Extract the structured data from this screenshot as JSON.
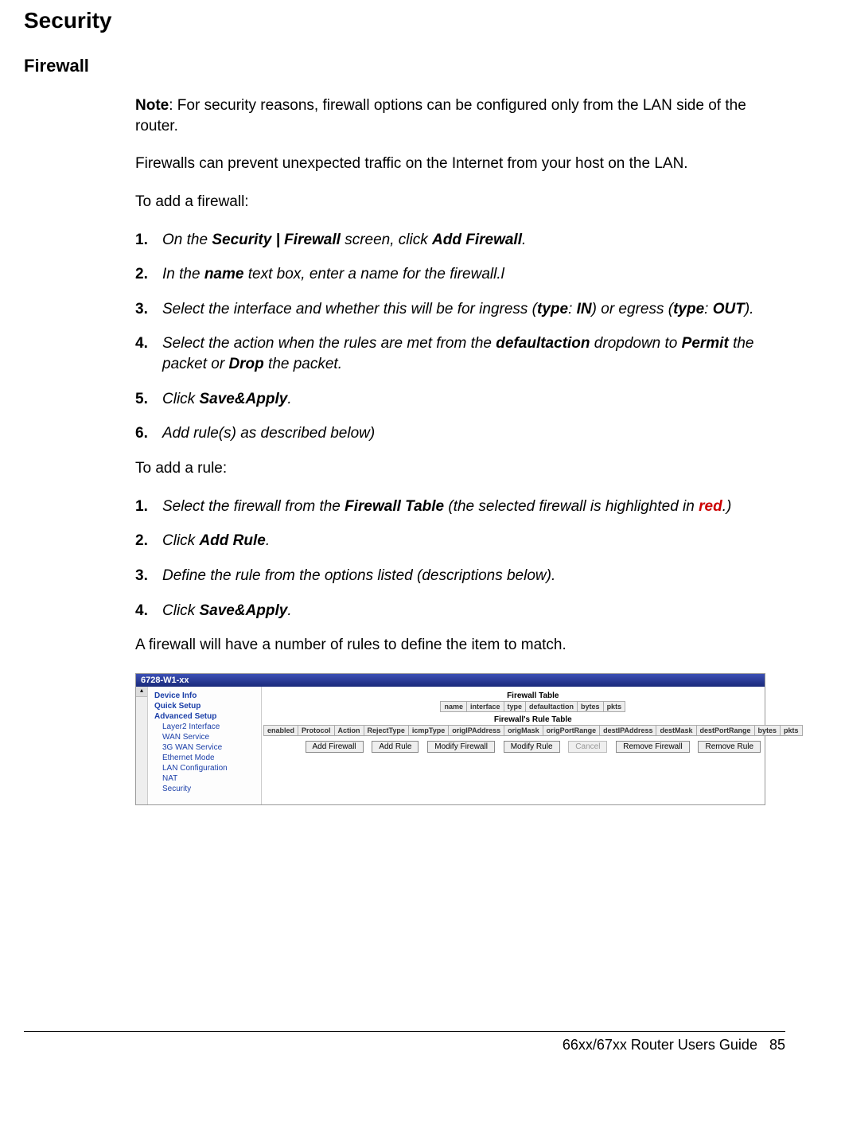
{
  "headings": {
    "h1": "Security",
    "h2": "Firewall"
  },
  "note": {
    "label": "Note",
    "text": ": For security reasons, firewall options can be configured only from the LAN side of the router."
  },
  "p_intro": "Firewalls can prevent unexpected traffic on the Internet from your host on the LAN.",
  "p_add_fw": "To add a firewall:",
  "steps_fw": [
    {
      "n": "1.",
      "pre": "On the ",
      "b1": "Security | Firewall",
      "mid": " screen, click ",
      "b2": "Add Firewall",
      "post": "."
    },
    {
      "n": "2.",
      "pre": "In the ",
      "b1": "name",
      "mid": " text box, enter a name for the firewall.l",
      "b2": "",
      "post": ""
    },
    {
      "n": "3.",
      "pre": "Select the interface and whether this will be for ingress (",
      "b1": "type",
      "mid": ": ",
      "b2": "IN",
      "post": ") or egress (",
      "b3": "type",
      "mid2": ": ",
      "b4": "OUT",
      "post2": ")."
    },
    {
      "n": "4.",
      "pre": "Select the action when the rules are met from the ",
      "b1": "defaultaction",
      "mid": " dropdown to ",
      "b2": "Permit",
      "post": " the packet or ",
      "b3": "Drop",
      "post2": " the packet."
    },
    {
      "n": "5.",
      "pre": "Click ",
      "b1": "Save&Apply",
      "post": "."
    },
    {
      "n": "6.",
      "pre": "Add rule(s) as described below)",
      "b1": "",
      "post": ""
    }
  ],
  "p_add_rule": "To add a rule:",
  "steps_rule": [
    {
      "n": "1.",
      "pre": "Select the firewall from the ",
      "b1": "Firewall Table",
      "mid": " (the selected firewall is highlighted in ",
      "red": "red",
      "post": ".)"
    },
    {
      "n": "2.",
      "pre": "Click ",
      "b1": "Add Rule",
      "post": "."
    },
    {
      "n": "3.",
      "pre": "Define the rule from the options listed (descriptions below).",
      "b1": "",
      "post": ""
    },
    {
      "n": "4.",
      "pre": "Click ",
      "b1": "Save&Apply",
      "post": "."
    }
  ],
  "p_tail": "A firewall will have a number of rules to define the item to match.",
  "screenshot": {
    "title": "6728-W1-xx",
    "sidebar": {
      "l1": [
        "Device Info",
        "Quick Setup",
        "Advanced Setup"
      ],
      "l2": [
        "Layer2 Interface",
        "WAN Service",
        "3G WAN Service",
        "Ethernet Mode",
        "LAN Configuration",
        "NAT",
        "Security"
      ]
    },
    "tbl1_title": "Firewall Table",
    "tbl1_cols": [
      "name",
      "interface",
      "type",
      "defaultaction",
      "bytes",
      "pkts"
    ],
    "tbl2_title": "Firewall's Rule Table",
    "tbl2_cols": [
      "enabled",
      "Protocol",
      "Action",
      "RejectType",
      "icmpType",
      "origIPAddress",
      "origMask",
      "origPortRange",
      "destIPAddress",
      "destMask",
      "destPortRange",
      "bytes",
      "pkts"
    ],
    "buttons": [
      "Add Firewall",
      "Add Rule",
      "Modify Firewall",
      "Modify Rule",
      "Cancel",
      "Remove Firewall",
      "Remove Rule"
    ]
  },
  "footer": {
    "text": "66xx/67xx Router Users Guide",
    "page": "85"
  }
}
